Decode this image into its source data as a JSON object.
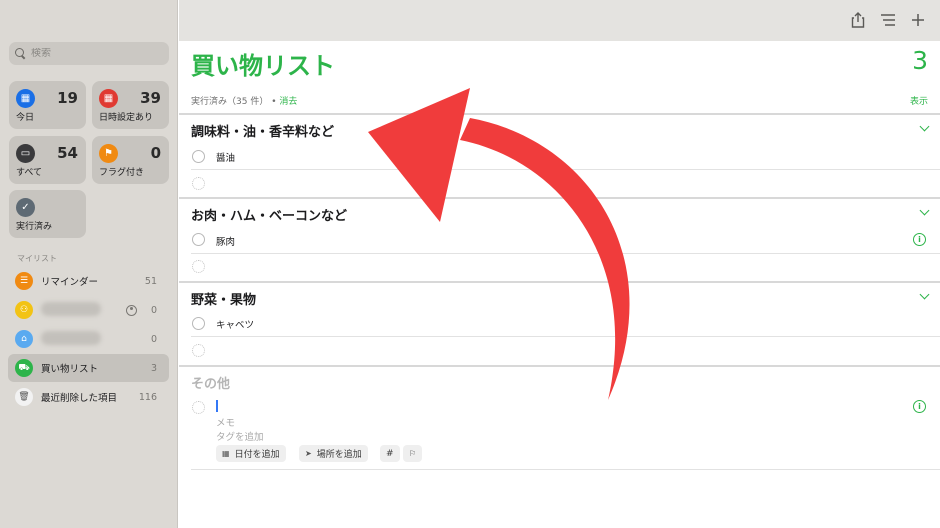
{
  "sidebar": {
    "search_placeholder": "検索",
    "cards": [
      {
        "label": "今日",
        "count": "19",
        "color": "#1a6fe6",
        "icon": "calendar-today-icon"
      },
      {
        "label": "日時設定あり",
        "count": "39",
        "color": "#e03a32",
        "icon": "calendar-icon"
      },
      {
        "label": "すべて",
        "count": "54",
        "color": "#3a3a3c",
        "icon": "tray-icon"
      },
      {
        "label": "フラグ付き",
        "count": "0",
        "color": "#f08a12",
        "icon": "flag-icon"
      },
      {
        "label": "実行済み",
        "count": "",
        "color": "#5e6a74",
        "icon": "checkmark-icon"
      }
    ],
    "mylists_header": "マイリスト",
    "lists": [
      {
        "label": "リマインダー",
        "count": "51",
        "color": "#f08a12",
        "icon": "list-icon"
      },
      {
        "label": "",
        "count": "0",
        "color": "#f2c315",
        "icon": "people-icon"
      },
      {
        "label": "",
        "count": "0",
        "color": "#5aaaf0",
        "icon": "house-icon"
      },
      {
        "label": "買い物リスト",
        "count": "3",
        "color": "#2db44a",
        "icon": "cart-icon"
      },
      {
        "label": "最近削除した項目",
        "count": "116",
        "color": "#f2f2f2",
        "icon": "trash-icon"
      }
    ]
  },
  "main": {
    "title": "買い物リスト",
    "count": "3",
    "done_text": "実行済み（35 件）",
    "done_sep": "•",
    "clear_label": "消去",
    "show_label": "表示",
    "sections": [
      {
        "title": "調味料・油・香辛料など",
        "items": [
          "醤油"
        ]
      },
      {
        "title": "お肉・ハム・ベーコンなど",
        "items": [
          "豚肉"
        ]
      },
      {
        "title": "野菜・果物",
        "items": [
          "キャベツ"
        ]
      }
    ],
    "other": {
      "title": "その他",
      "memo_placeholder": "メモ",
      "tag_placeholder": "タグを追加",
      "add_date": "日付を追加",
      "add_location": "場所を追加",
      "hash": "#"
    },
    "accent_color": "#2db44a",
    "arrow_color": "#f03c3c"
  }
}
